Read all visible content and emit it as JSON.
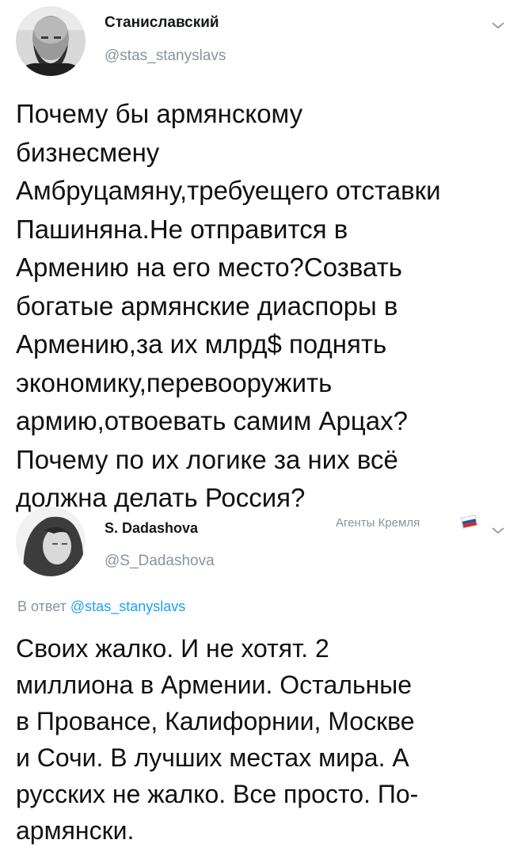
{
  "tweets": [
    {
      "display_name": "Станиславский",
      "handle": "@stas_stanyslavs",
      "text": "Почему бы армянскому\nбизнесмену\nАмбруцамяну,требуещего отставки\nПашиняна.Не отправится в\nАрмению на его место?Созвать\nбогатые армянские диаспоры в\nАрмению,за их млрд$ поднять\nэкономику,перевооружить\nармию,отвоевать самим Арцах?\nПочему по их логике за них всё\nдолжна делать Россия?",
      "menu_icon": "chevron-down-icon",
      "avatar_icon": "user-avatar"
    },
    {
      "display_name": "S. Dadashova",
      "handle": "@S_Dadashova",
      "badge_text": "Агенты Кремля",
      "badge_icon": "russian-flag-icon",
      "reply_prefix": "В ответ",
      "reply_mention": "@stas_stanyslavs",
      "text": "Своих жалко. И не хотят. 2\nмиллиона в Армении. Остальные\nв Провансе, Калифорнии, Москве\nи Сочи. В лучших местах мира. А\nрусских не жалко. Все просто. По-\nармянски.",
      "menu_icon": "chevron-down-icon",
      "avatar_icon": "user-avatar"
    }
  ],
  "colors": {
    "name": "#14171a",
    "secondary": "#8a939c",
    "link": "#1da1f2",
    "text": "#111111"
  }
}
